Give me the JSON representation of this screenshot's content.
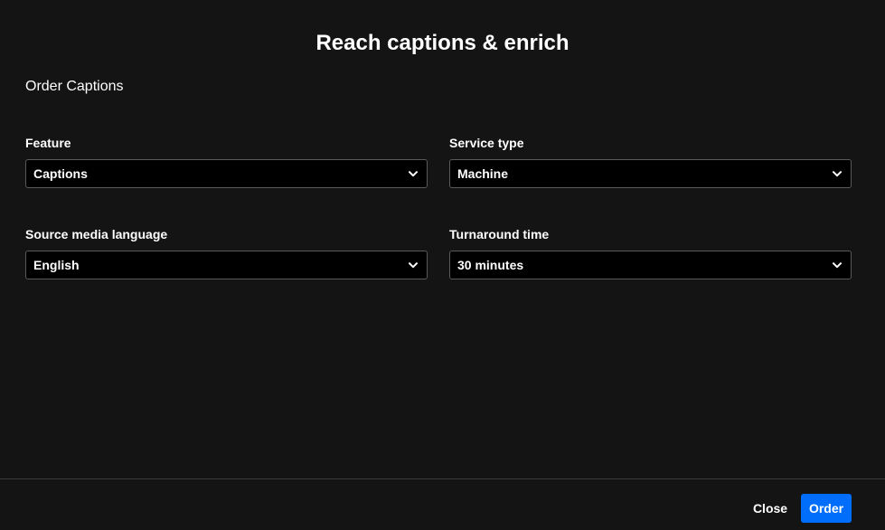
{
  "dialog": {
    "title": "Reach captions & enrich",
    "section_label": "Order Captions"
  },
  "fields": {
    "feature": {
      "label": "Feature",
      "value": "Captions",
      "icon": "chevron-down-icon"
    },
    "service_type": {
      "label": "Service type",
      "value": "Machine",
      "icon": "chevron-down-icon"
    },
    "source_language": {
      "label": "Source media language",
      "value": "English",
      "icon": "chevron-down-icon"
    },
    "turnaround": {
      "label": "Turnaround time",
      "value": "30 minutes",
      "icon": "chevron-down-icon"
    }
  },
  "footer": {
    "close_label": "Close",
    "order_label": "Order"
  },
  "colors": {
    "background": "#141414",
    "select_background": "#000000",
    "accent": "#006efa",
    "border": "#5a5a5a"
  }
}
